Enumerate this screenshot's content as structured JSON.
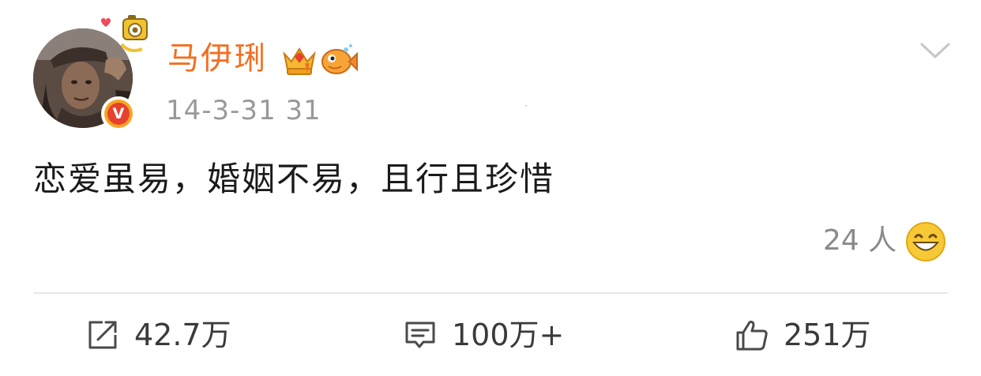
{
  "post": {
    "author": {
      "name": "马伊琍",
      "avatar_icon": "user-avatar",
      "verified_icon": "verified-v-badge",
      "verified_mark": "V",
      "badges": [
        "crown-member-badge-icon",
        "fish-badge-icon"
      ]
    },
    "timestamp": "14-3-31 31",
    "text": "恋爱虽易，婚姻不易，且行且珍惜",
    "reaction": {
      "count": "24 人",
      "emoji": "grinning-face-icon"
    },
    "actions": {
      "repost": {
        "label": "42.7万",
        "icon": "repost-icon"
      },
      "comment": {
        "label": "100万+",
        "icon": "comment-icon"
      },
      "like": {
        "label": "251万",
        "icon": "thumbs-up-icon"
      }
    },
    "menu_icon": "chevron-down-icon"
  },
  "colors": {
    "name": "#f26f21",
    "timestamp": "#999999",
    "text": "#1a1a1a",
    "verified_outer": "#f5a623",
    "verified_inner": "#e8402f",
    "divider": "#e6e6e6"
  }
}
